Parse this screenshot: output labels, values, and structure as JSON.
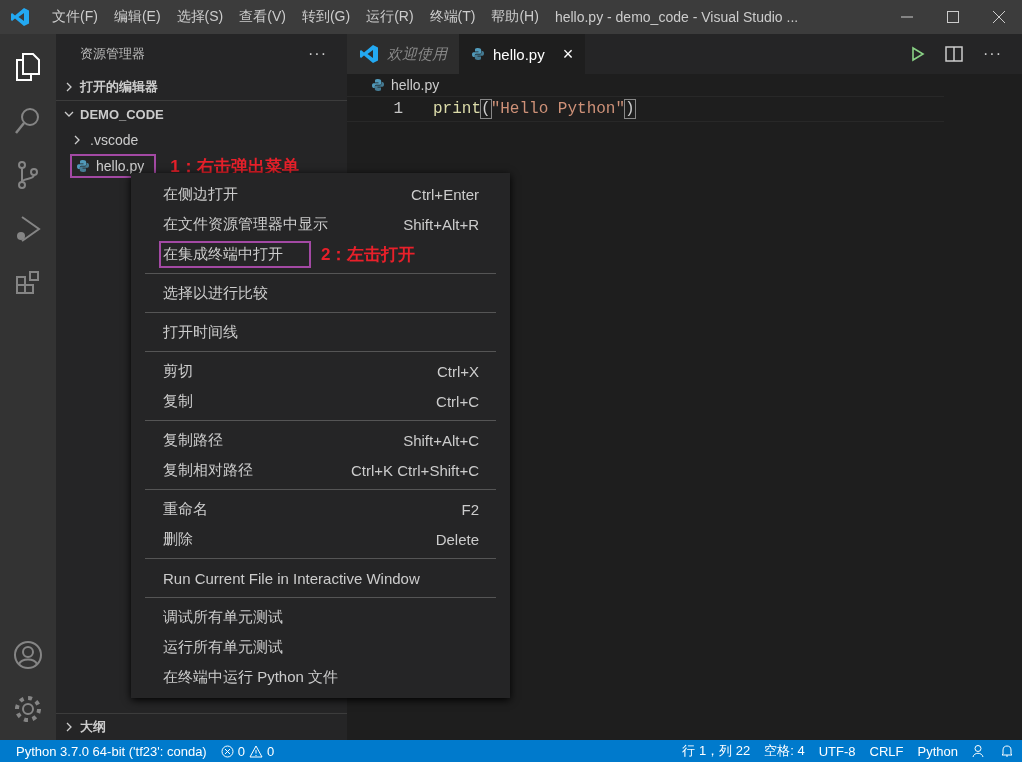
{
  "title_bar": {
    "menus": [
      "文件(F)",
      "编辑(E)",
      "选择(S)",
      "查看(V)",
      "转到(G)",
      "运行(R)",
      "终端(T)",
      "帮助(H)"
    ],
    "title": "hello.py - demo_code - Visual Studio ..."
  },
  "sidebar": {
    "title": "资源管理器",
    "more": "···",
    "sections": [
      {
        "label": "打开的编辑器",
        "expanded": false
      },
      {
        "label": "DEMO_CODE",
        "expanded": true,
        "items": [
          {
            "kind": "folder",
            "label": ".vscode",
            "expanded": false
          },
          {
            "kind": "file",
            "label": "hello.py",
            "highlighted": true,
            "annotation": "1：右击弹出菜单"
          }
        ]
      }
    ],
    "outline": {
      "label": "大纲",
      "expanded": false
    }
  },
  "tabs": [
    {
      "label": "欢迎使用",
      "kind": "welcome",
      "selected": false
    },
    {
      "label": "hello.py",
      "kind": "python",
      "selected": true,
      "close": "×"
    }
  ],
  "editor_actions": {
    "more": "···"
  },
  "breadcrumb": "hello.py",
  "code": [
    {
      "number": "1",
      "tokens": [
        {
          "kind": "function",
          "text": "print"
        },
        {
          "kind": "bracket",
          "text": "("
        },
        {
          "kind": "string",
          "text": "\"Hello Python\""
        },
        {
          "kind": "bracket",
          "text": ")"
        }
      ]
    }
  ],
  "context_menu": {
    "groups": [
      [
        {
          "label": "在侧边打开",
          "shortcut": "Ctrl+Enter",
          "highlighted": false
        },
        {
          "label": "在文件资源管理器中显示",
          "shortcut": "Shift+Alt+R",
          "highlighted": false
        },
        {
          "label": "在集成终端中打开",
          "highlighted": true,
          "annotation": "2：左击打开"
        }
      ],
      [
        {
          "label": "选择以进行比较",
          "highlighted": false
        }
      ],
      [
        {
          "label": "打开时间线",
          "highlighted": false
        }
      ],
      [
        {
          "label": "剪切",
          "shortcut": "Ctrl+X",
          "highlighted": false
        },
        {
          "label": "复制",
          "shortcut": "Ctrl+C",
          "highlighted": false
        }
      ],
      [
        {
          "label": "复制路径",
          "shortcut": "Shift+Alt+C",
          "highlighted": false
        },
        {
          "label": "复制相对路径",
          "shortcut": "Ctrl+K Ctrl+Shift+C",
          "highlighted": false
        }
      ],
      [
        {
          "label": "重命名",
          "shortcut": "F2",
          "highlighted": false
        },
        {
          "label": "删除",
          "shortcut": "Delete",
          "highlighted": false
        }
      ],
      [
        {
          "label": "Run Current File in Interactive Window",
          "highlighted": false
        }
      ],
      [
        {
          "label": "调试所有单元测试",
          "highlighted": false
        },
        {
          "label": "运行所有单元测试",
          "highlighted": false
        },
        {
          "label": "在终端中运行 Python 文件",
          "highlighted": false
        }
      ]
    ]
  },
  "status_bar": {
    "interpreter": "Python 3.7.0 64-bit ('tf23': conda)",
    "errors": "0",
    "warnings": "0",
    "right": [
      "行 1，列 22",
      "空格: 4",
      "UTF-8",
      "CRLF",
      "Python"
    ]
  }
}
